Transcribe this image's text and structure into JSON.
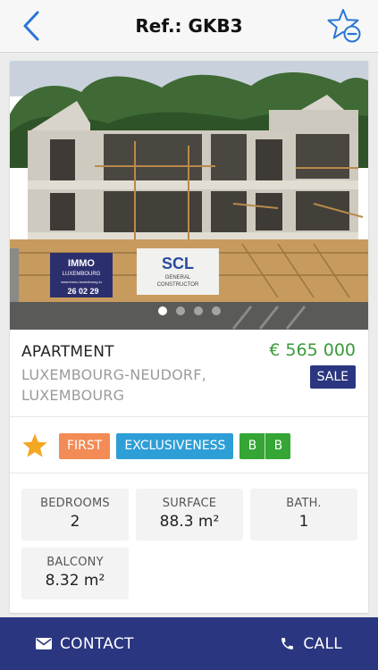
{
  "header": {
    "title": "Ref.: GKB3",
    "back_icon": "chevron-left-icon",
    "favorite_icon": "star-minus-icon"
  },
  "gallery": {
    "image": "photo of apartment building under construction with IMMO LUXEMBOURG and SCL General Constructor signs",
    "total_photos": 4,
    "active_photo": 1,
    "sign_immo": {
      "title": "IMMO",
      "subtitle": "LUXEMBOURG",
      "url": "www.immo-luxembourg.lu",
      "phone": "26 02 29"
    },
    "sign_scl": {
      "letters": "SCL",
      "line1": "GENERAL",
      "line2": "CONSTRUCTOR"
    }
  },
  "listing": {
    "type": "APARTMENT",
    "price": "€ 565 000",
    "location": "LUXEMBOURG-NEUDORF, LUXEMBOURG",
    "transaction": "SALE"
  },
  "tags": {
    "star_icon": "star-icon",
    "first": "FIRST",
    "exclusiveness": "EXCLUSIVENESS",
    "energy": [
      "B",
      "B"
    ]
  },
  "stats": [
    {
      "label": "BEDROOMS",
      "value": "2"
    },
    {
      "label": "SURFACE",
      "value": "88.3 m²"
    },
    {
      "label": "BATH.",
      "value": "1"
    },
    {
      "label": "BALCONY",
      "value": "8.32 m²"
    }
  ],
  "actions": {
    "contact": "CONTACT",
    "contact_icon": "envelope-icon",
    "call": "CALL",
    "call_icon": "phone-icon"
  },
  "colors": {
    "accent_blue": "#2a76d6",
    "price_green": "#3a9a3a",
    "navy": "#2a3680",
    "tag_orange": "#f28b55",
    "tag_blue": "#2e9ed6",
    "energy_green": "#35a535",
    "star_gold": "#f5a623"
  }
}
